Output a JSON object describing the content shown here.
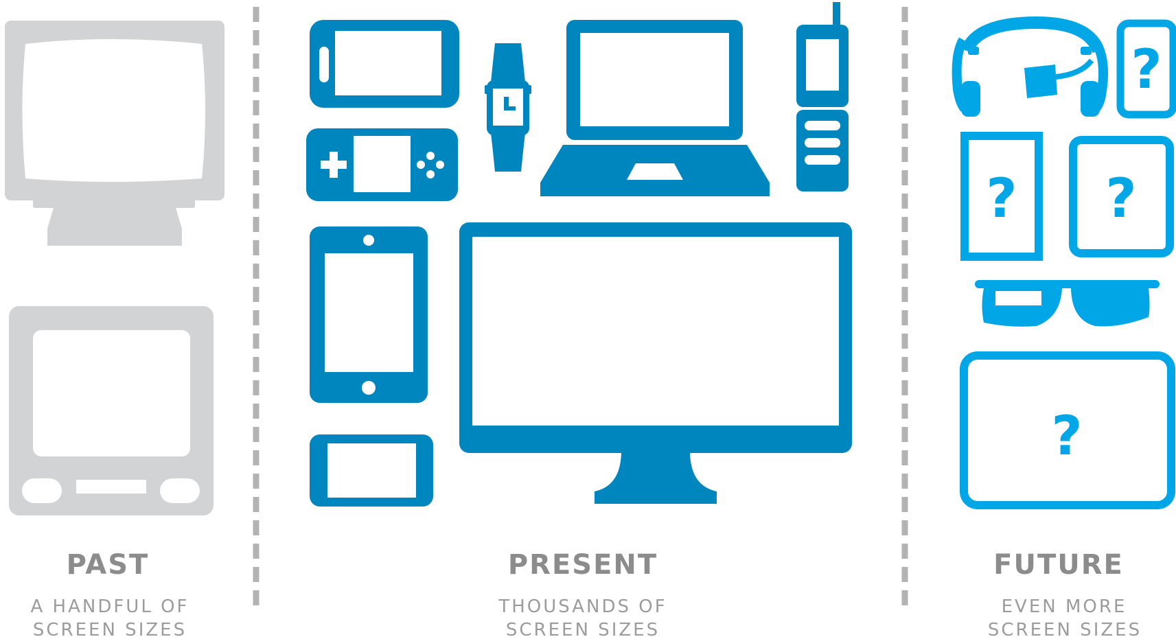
{
  "colors": {
    "past": "#d1d3d4",
    "present": "#0086be",
    "future": "#00a6e6",
    "divider": "#b3b3b3",
    "caption_title": "#8c8c8c",
    "caption_sub": "#9c9c9c"
  },
  "sections": {
    "past": {
      "title": "PAST",
      "subtitle_line1": "A HANDFUL OF",
      "subtitle_line2": "SCREEN SIZES",
      "devices": [
        "crt-monitor-icon",
        "classic-computer-icon"
      ]
    },
    "present": {
      "title": "PRESENT",
      "subtitle_line1": "THOUSANDS OF",
      "subtitle_line2": "SCREEN SIZES",
      "devices": [
        "landscape-phone-icon",
        "smartwatch-icon",
        "laptop-icon",
        "feature-phone-icon",
        "handheld-game-console-icon",
        "smartphone-icon",
        "small-phone-icon",
        "desktop-monitor-icon"
      ]
    },
    "future": {
      "title": "FUTURE",
      "subtitle_line1": "EVEN MORE",
      "subtitle_line2": "SCREEN SIZES",
      "question_mark": "?",
      "devices": [
        "headset-icon",
        "unknown-small-device-icon",
        "unknown-tablet-icon",
        "unknown-square-device-icon",
        "smart-glasses-icon",
        "unknown-wide-screen-icon"
      ]
    }
  }
}
